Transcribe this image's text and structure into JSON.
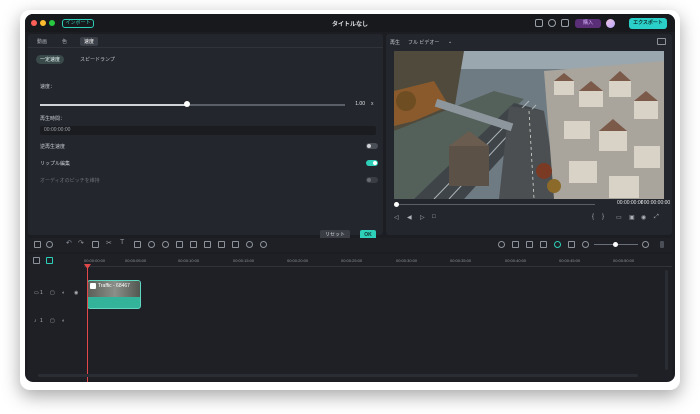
{
  "window": {
    "title": "タイトルなし",
    "import_label": "インポート",
    "buy_label": "購入",
    "export_label": "エクスポート"
  },
  "left_panel": {
    "tabs": [
      "動画",
      "色",
      "速度"
    ],
    "subtabs": [
      "一定速度",
      "スピードランプ"
    ],
    "speed_label": "速度：",
    "speed_value": "1.00",
    "speed_unit": "x",
    "duration_label": "再生時間：",
    "duration_value": "00:00:00:00",
    "reverse_label": "逆再生速度",
    "ripple_label": "リップル編集",
    "audio_pitch_label": "オーディオのピッチを維持",
    "reset_label": "リセット",
    "ok_label": "OK"
  },
  "preview": {
    "player_label": "再生",
    "quality_label": "フル ビデオー",
    "current_time": "00:00:00:00",
    "total_time": "/ 00:00:00:00"
  },
  "timeline": {
    "ruler_labels": [
      "00:00:00:00",
      "00:00:05:00",
      "00:00:10:00",
      "00:00:15:00",
      "00:00:20:00",
      "00:00:25:00",
      "00:00:30:00",
      "00:00:35:00",
      "00:00:40:00",
      "00:00:45:00",
      "00:00:50:00"
    ],
    "clip_label": "Traffic - 68467",
    "track_video": "1",
    "track_audio": "1"
  },
  "colors": {
    "accent": "#2ecfb8",
    "panel": "#23262c",
    "playhead": "#e0484a"
  }
}
